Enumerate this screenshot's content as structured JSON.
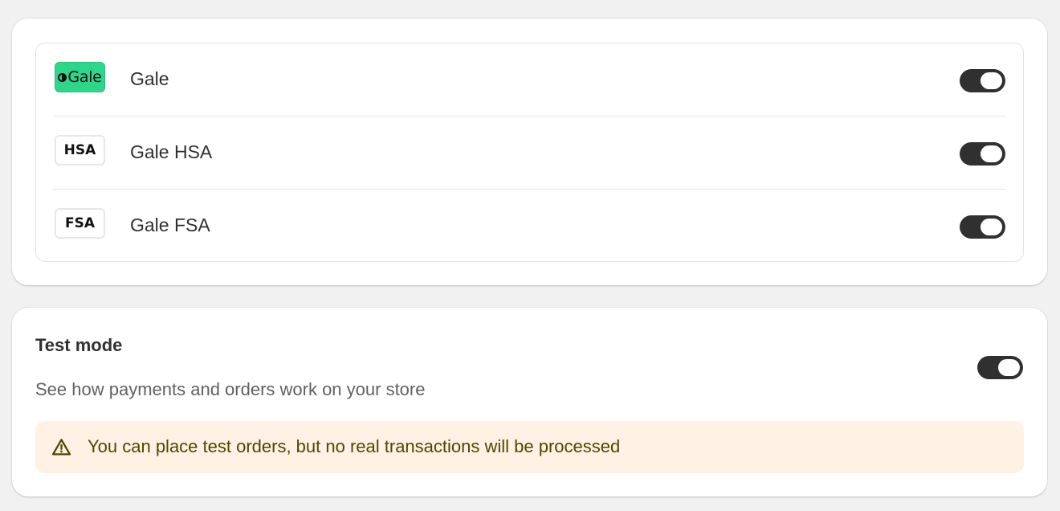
{
  "payment_methods": {
    "items": [
      {
        "name": "Gale",
        "logo_text": "Gale",
        "logo_style": "brand",
        "enabled": true
      },
      {
        "name": "Gale HSA",
        "logo_text": "HSA",
        "logo_style": "boxed",
        "enabled": true
      },
      {
        "name": "Gale FSA",
        "logo_text": "FSA",
        "logo_style": "boxed",
        "enabled": true
      }
    ]
  },
  "test_mode": {
    "title": "Test mode",
    "description": "See how payments and orders work on your store",
    "enabled": true,
    "banner": {
      "text": "You can place test orders, but no real transactions will be processed",
      "icon": "warning-icon"
    }
  },
  "colors": {
    "toggle_on": "#303030",
    "gale_brand": "#2fd58a",
    "banner_bg": "#fff1e3",
    "banner_text": "#4f4700"
  }
}
